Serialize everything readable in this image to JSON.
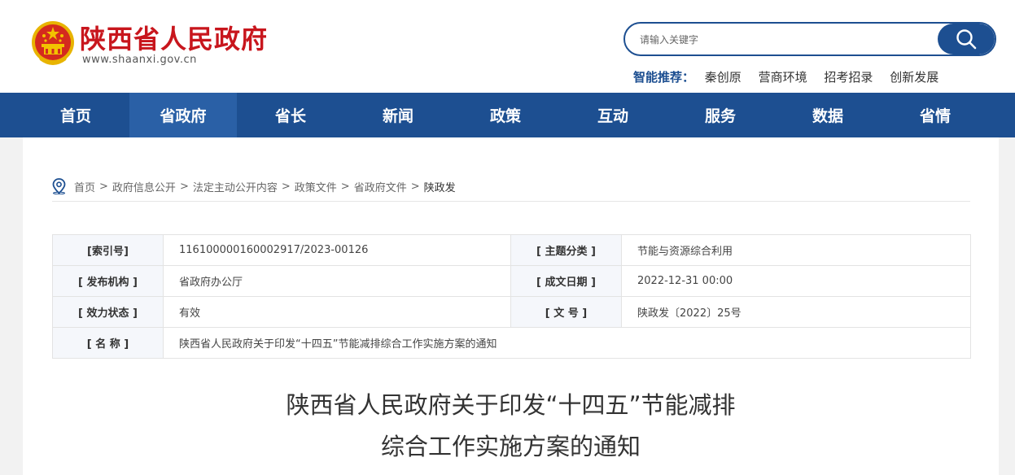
{
  "header": {
    "site_title": "陕西省人民政府",
    "site_url": "www.shaanxi.gov.cn",
    "emblem_icon": "national-emblem-icon",
    "search": {
      "placeholder": "请输入关键字",
      "icon": "search-icon"
    },
    "smart_label": "智能推荐：",
    "smart_keywords": [
      "秦创原",
      "营商环境",
      "招考招录",
      "创新发展"
    ]
  },
  "nav": {
    "items": [
      "首页",
      "省政府",
      "省长",
      "新闻",
      "政策",
      "互动",
      "服务",
      "数据",
      "省情"
    ],
    "active_index": 1
  },
  "breadcrumb": {
    "icon": "location-pin-icon",
    "items": [
      "首页",
      "政府信息公开",
      "法定主动公开内容",
      "政策文件",
      "省政府文件"
    ],
    "current": "陕政发",
    "separator": ">"
  },
  "meta_table": {
    "index_label": "[索引号]",
    "index_value": "116100000160002917/2023-00126",
    "topic_label": "[ 主题分类 ]",
    "topic_value": "节能与资源综合利用",
    "issuer_label": "[ 发布机构 ]",
    "issuer_value": "省政府办公厅",
    "date_label": "[ 成文日期 ]",
    "date_value": "2022-12-31 00:00",
    "status_label": "[ 效力状态 ]",
    "status_value": "有效",
    "docno_label": "[ 文 号 ]",
    "docno_value": "陕政发〔2022〕25号",
    "name_label": "[ 名 称 ]",
    "name_value": "陕西省人民政府关于印发“十四五”节能减排综合工作实施方案的通知"
  },
  "document": {
    "title_line1": "陕西省人民政府关于印发“十四五”节能减排",
    "title_line2": "综合工作实施方案的通知"
  },
  "colors": {
    "brand_red": "#c8161d",
    "nav_blue": "#1d4f91",
    "nav_active": "#2a60a6"
  }
}
